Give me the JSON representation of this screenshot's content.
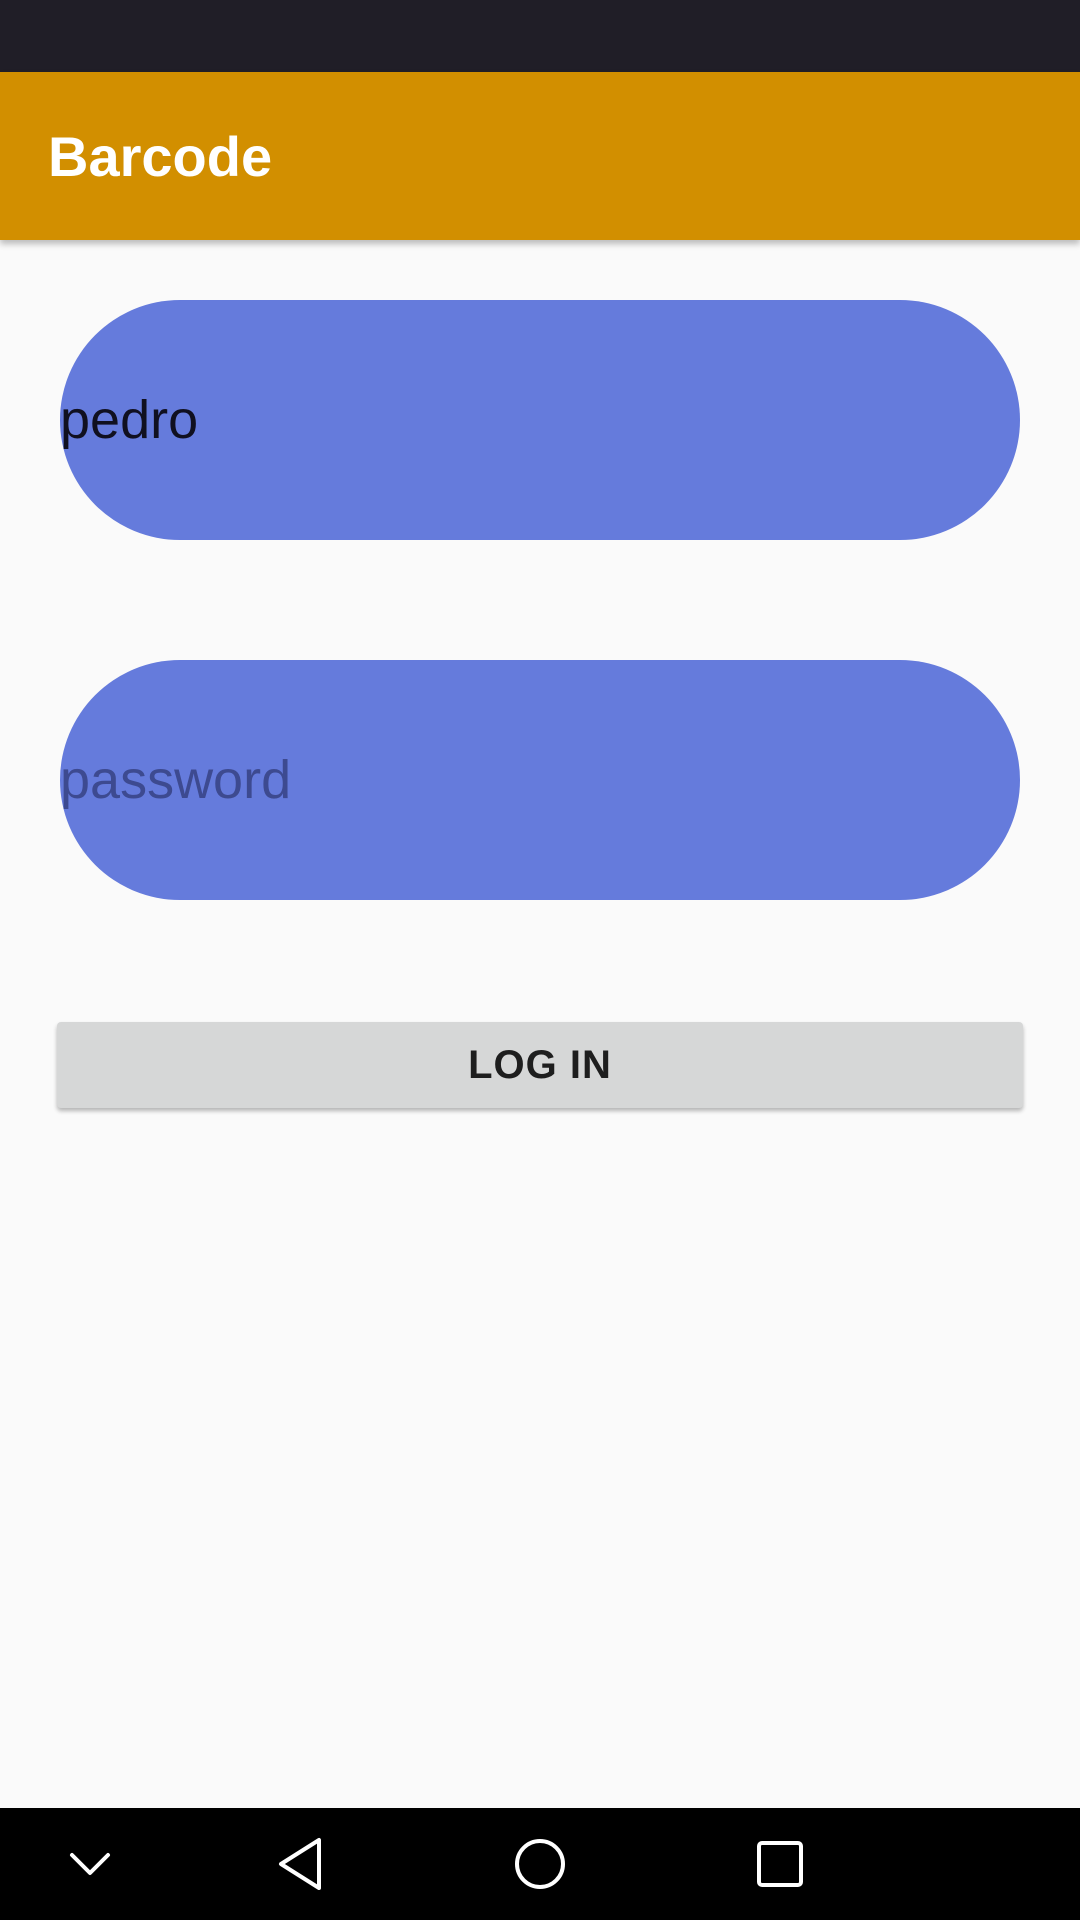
{
  "app_bar": {
    "title": "Barcode",
    "color": "#d28f00"
  },
  "login_form": {
    "username": {
      "value": "pedro",
      "placeholder": ""
    },
    "password": {
      "value": "",
      "placeholder": "password"
    },
    "field_color": "#657bdc",
    "login_button_label": "LOG IN"
  },
  "nav_bar": {
    "icons": [
      "chevron-down-icon",
      "back-icon",
      "home-icon",
      "recents-icon"
    ]
  }
}
